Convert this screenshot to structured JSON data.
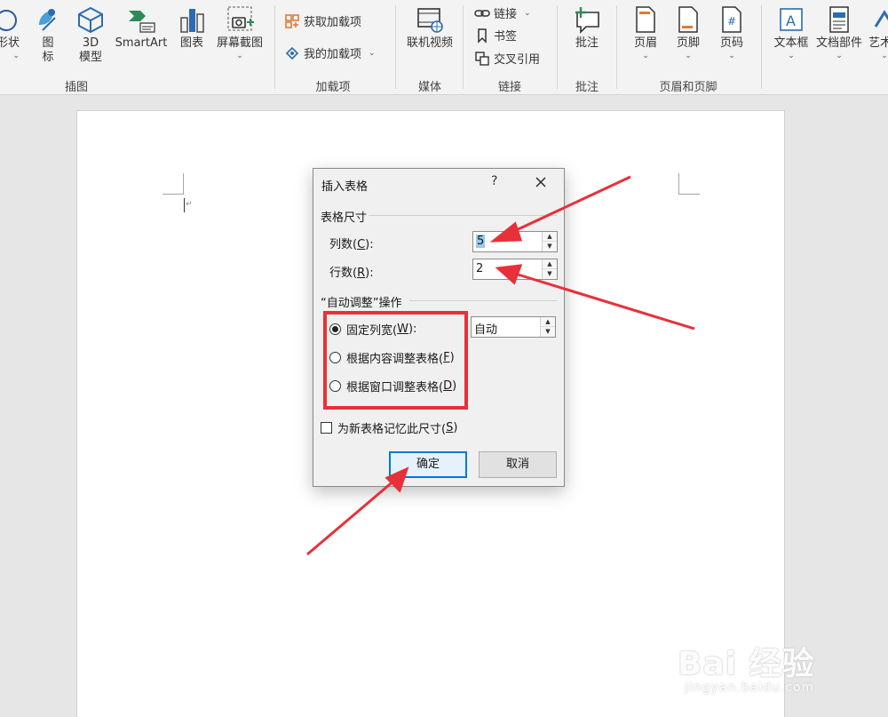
{
  "ribbon": {
    "buttons": {
      "shapes_label": "形状",
      "icons_label": "图\n标",
      "model3d_label": "3D\n模型",
      "smartart_label": "SmartArt",
      "chart_label": "图表",
      "screenshot_label": "屏幕截图",
      "get_addins_label": "获取加载项",
      "my_addins_label": "我的加载项",
      "online_video_label": "联机视频",
      "link_label": "链接",
      "bookmark_label": "书签",
      "crossref_label": "交叉引用",
      "comment_label": "批注",
      "header_label": "页眉",
      "footer_label": "页脚",
      "pagenum_label": "页码",
      "textbox_label": "文本框",
      "quickparts_label": "文档部件",
      "wordart_label": "艺术"
    },
    "groups": {
      "illustrations": "插图",
      "addins": "加载项",
      "media": "媒体",
      "links": "链接",
      "comments": "批注",
      "header_footer": "页眉和页脚"
    },
    "chevron": "⌄",
    "colors": {
      "accent_blue": "#2b6cb0",
      "accent_orange": "#e07b39",
      "accent_green": "#2e8b57"
    }
  },
  "dialog": {
    "title": "插入表格",
    "help": "?",
    "close_icon": "close-icon",
    "table_size_section": "表格尺寸",
    "columns_label_pre": "列数(",
    "columns_key": "C",
    "columns_label_post": "):",
    "columns_value": "5",
    "rows_label_pre": "行数(",
    "rows_key": "R",
    "rows_label_post": "):",
    "rows_value": "2",
    "autofit_section": "“自动调整”操作",
    "fixed_width_pre": "固定列宽(",
    "fixed_width_key": "W",
    "fixed_width_post": "):",
    "fixed_width_value": "自动",
    "autofit_content_pre": "根据内容调整表格(",
    "autofit_content_key": "F",
    "autofit_content_post": ")",
    "autofit_window_pre": "根据窗口调整表格(",
    "autofit_window_key": "D",
    "autofit_window_post": ")",
    "remember_pre": "为新表格记忆此尺寸(",
    "remember_key": "S",
    "remember_post": ")",
    "ok_label": "确定",
    "cancel_label": "取消",
    "selected_option": "固定列宽",
    "remember_checked": false
  },
  "annotations": {
    "color": "#e8303a"
  },
  "watermark": {
    "main": "Bai 经验",
    "sub": "jingyan.baidu.com"
  }
}
